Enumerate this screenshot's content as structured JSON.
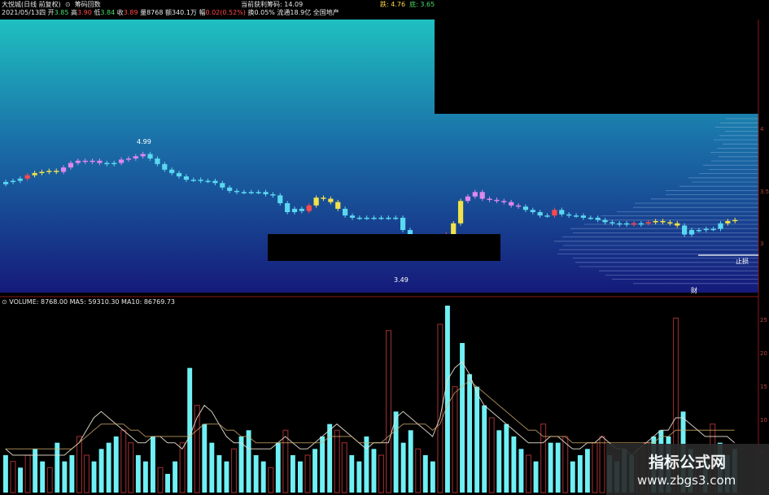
{
  "header": {
    "title": "大悦城(日线 前复权)",
    "indicator": "筹码回数",
    "date": "2021/05/13四",
    "open_label": "开",
    "open": "3.85",
    "high_label": "高",
    "high": "3.90",
    "low_label": "低",
    "low": "3.84",
    "close_label": "收",
    "close": "3.89",
    "vol_label": "量",
    "vol": "8768",
    "amount_label": "额",
    "amount": "340.1万",
    "change_label": "幅",
    "change": "0.02(0.52%)",
    "turnover": "换0.05% 流通18.9亿 全国地产",
    "profit_label": "当前获利筹码: ",
    "profit": "14.09",
    "right_a_label": "跌: ",
    "right_a": "4.76",
    "right_b_label": "底: ",
    "right_b": "3.65"
  },
  "annotations": {
    "high_marker": "4.99",
    "low_marker": "3.49",
    "stop_label": "止损",
    "bottom_marker": "财"
  },
  "price_axis": {
    "ticks": [
      "4",
      "3.5",
      "3"
    ]
  },
  "volume_header": {
    "label": "VOLUME: 8768.00",
    "ma5": "MA5: 59310.30",
    "ma10": "MA10: 86769.73"
  },
  "volume_axis": {
    "ticks": [
      "25",
      "20",
      "15",
      "10",
      "5"
    ]
  },
  "watermark": {
    "title": "指标公式网",
    "url": "www.zbgs3.com"
  },
  "colors": {
    "up": "#ff4a4a",
    "down": "#5ad8f0",
    "yellow": "#f2e24a",
    "pink": "#dd88ee",
    "white": "#ffffff",
    "vol_up": "#8a2a2a",
    "vol_down": "#6ff0f4",
    "ma_line": "#e8e0d0"
  },
  "chart_data": [
    {
      "type": "candlestick",
      "series": [
        {
          "name": "close",
          "values": [
            4.39,
            4.4,
            4.42,
            4.45,
            4.47,
            4.48,
            4.49,
            4.48,
            4.52,
            4.56,
            4.58,
            4.57,
            4.58,
            4.56,
            4.55,
            4.56,
            4.59,
            4.6,
            4.62,
            4.64,
            4.6,
            4.55,
            4.5,
            4.47,
            4.44,
            4.41,
            4.41,
            4.4,
            4.4,
            4.38,
            4.34,
            4.31,
            4.3,
            4.3,
            4.3,
            4.3,
            4.28,
            4.27,
            4.2,
            4.12,
            4.15,
            4.13,
            4.18,
            4.25,
            4.24,
            4.21,
            4.15,
            4.09,
            4.07,
            4.07,
            4.07,
            4.07,
            4.07,
            4.07,
            4.07,
            3.96,
            3.9,
            3.87,
            3.87,
            3.88,
            3.9,
            3.92,
            4.02,
            4.22,
            4.26,
            4.3,
            4.24,
            4.23,
            4.22,
            4.21,
            4.18,
            4.17,
            4.14,
            4.12,
            4.09,
            4.09,
            4.14,
            4.1,
            4.09,
            4.09,
            4.07,
            4.07,
            4.05,
            4.03,
            4.02,
            4.01,
            4.02,
            4.01,
            4.02,
            4.03,
            4.04,
            4.03,
            4.02,
            4.0,
            3.92,
            3.96,
            3.96,
            3.97,
            3.97,
            4.02,
            4.04,
            4.05
          ],
          "colors": [
            "d",
            "d",
            "d",
            "u",
            "y",
            "y",
            "y",
            "y",
            "p",
            "p",
            "p",
            "p",
            "p",
            "p",
            "d",
            "d",
            "p",
            "p",
            "p",
            "p",
            "d",
            "d",
            "d",
            "d",
            "d",
            "d",
            "d",
            "d",
            "d",
            "d",
            "d",
            "d",
            "d",
            "d",
            "d",
            "d",
            "d",
            "d",
            "d",
            "d",
            "d",
            "d",
            "u",
            "y",
            "y",
            "y",
            "y",
            "d",
            "d",
            "d",
            "d",
            "d",
            "d",
            "d",
            "d",
            "d",
            "d",
            "d",
            "d",
            "d",
            "d",
            "u",
            "y",
            "y",
            "p",
            "p",
            "p",
            "p",
            "p",
            "p",
            "p",
            "p",
            "d",
            "d",
            "d",
            "d",
            "u",
            "d",
            "d",
            "d",
            "d",
            "d",
            "d",
            "d",
            "d",
            "d",
            "d",
            "u",
            "d",
            "u",
            "y",
            "y",
            "y",
            "y",
            "d",
            "d",
            "d",
            "d",
            "d",
            "d",
            "y",
            "y"
          ]
        }
      ],
      "note_levels": {
        "high": 4.99,
        "low": 3.49
      }
    },
    {
      "type": "bar",
      "title": "VOLUME",
      "series": [
        {
          "name": "VOLUME",
          "values": [
            6,
            5,
            4,
            6,
            7,
            5,
            4,
            8,
            5,
            6,
            9,
            6,
            5,
            7,
            8,
            9,
            10,
            8,
            6,
            5,
            9,
            4,
            3,
            5,
            8,
            20,
            14,
            11,
            8,
            6,
            5,
            7,
            9,
            10,
            6,
            5,
            4,
            8,
            10,
            6,
            5,
            6,
            7,
            9,
            11,
            10,
            8,
            6,
            5,
            9,
            7,
            6,
            26,
            13,
            8,
            10,
            7,
            6,
            5,
            27,
            30,
            17,
            24,
            19,
            17,
            14,
            12,
            10,
            11,
            9,
            7,
            6,
            5,
            11,
            8,
            8,
            9,
            5,
            6,
            7,
            8,
            9,
            6,
            5,
            7,
            6,
            7,
            8,
            9,
            10,
            9,
            28,
            13,
            7,
            6,
            5,
            11,
            8,
            6,
            7
          ]
        },
        {
          "name": "MA5",
          "values": [
            7,
            6,
            6,
            6,
            6,
            6,
            6,
            6,
            6,
            7,
            8,
            10,
            12,
            13,
            12,
            11,
            10,
            9,
            8,
            8,
            9,
            9,
            8,
            8,
            7,
            9,
            12,
            14,
            13,
            11,
            9,
            8,
            8,
            7,
            7,
            7,
            7,
            8,
            9,
            8,
            7,
            7,
            8,
            9,
            10,
            11,
            10,
            9,
            8,
            7,
            8,
            8,
            8,
            12,
            13,
            12,
            11,
            10,
            9,
            12,
            18,
            20,
            21,
            19,
            16,
            14,
            13,
            12,
            11,
            10,
            9,
            8,
            8,
            8,
            9,
            9,
            8,
            7,
            7,
            8,
            8,
            9,
            8,
            7,
            7,
            6,
            7,
            8,
            9,
            10,
            10,
            12,
            12,
            11,
            10,
            9,
            9,
            9,
            9,
            8
          ]
        },
        {
          "name": "MA10",
          "values": [
            7,
            7,
            7,
            7,
            7,
            7,
            7,
            7,
            7,
            7,
            8,
            9,
            10,
            11,
            11,
            11,
            11,
            10,
            10,
            9,
            9,
            9,
            9,
            9,
            9,
            9,
            10,
            11,
            11,
            11,
            10,
            10,
            9,
            9,
            8,
            8,
            8,
            8,
            8,
            8,
            8,
            8,
            8,
            8,
            9,
            9,
            9,
            9,
            8,
            8,
            8,
            8,
            9,
            10,
            11,
            11,
            11,
            11,
            10,
            11,
            14,
            16,
            17,
            18,
            17,
            16,
            15,
            14,
            13,
            12,
            11,
            10,
            10,
            9,
            9,
            9,
            9,
            8,
            8,
            8,
            8,
            8,
            8,
            8,
            8,
            8,
            8,
            8,
            8,
            9,
            9,
            10,
            10,
            10,
            10,
            10,
            10,
            10,
            10,
            10
          ]
        }
      ]
    }
  ]
}
